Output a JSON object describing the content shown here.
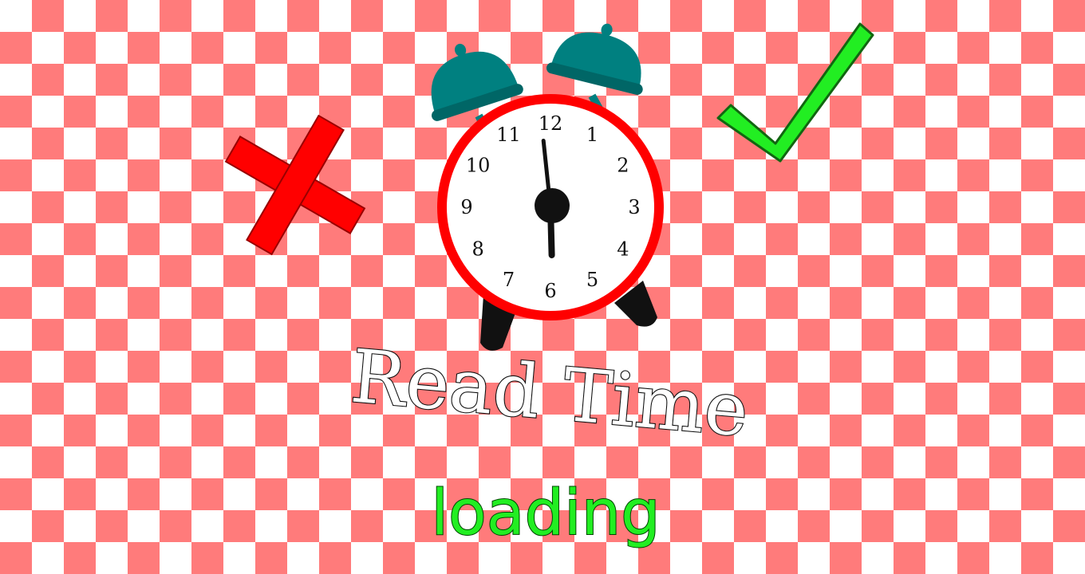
{
  "title": "Read Time",
  "status": "loading",
  "clock": {
    "numbers": [
      "12",
      "1",
      "2",
      "3",
      "4",
      "5",
      "6",
      "7",
      "8",
      "9",
      "10",
      "11"
    ],
    "hour_hand_hours": 5.95,
    "minute_hand_minutes": 59
  },
  "icons": {
    "wrong": "red-cross-icon",
    "right": "green-checkmark-icon",
    "clock": "alarm-clock-icon"
  },
  "colors": {
    "checker": "#ff7b7b",
    "cross": "#ff0000",
    "check": "#22ee22",
    "clock_rim": "#ff0000",
    "bells": "#008080",
    "title_fill": "#ffffff",
    "loading_fill": "#22ee22"
  }
}
